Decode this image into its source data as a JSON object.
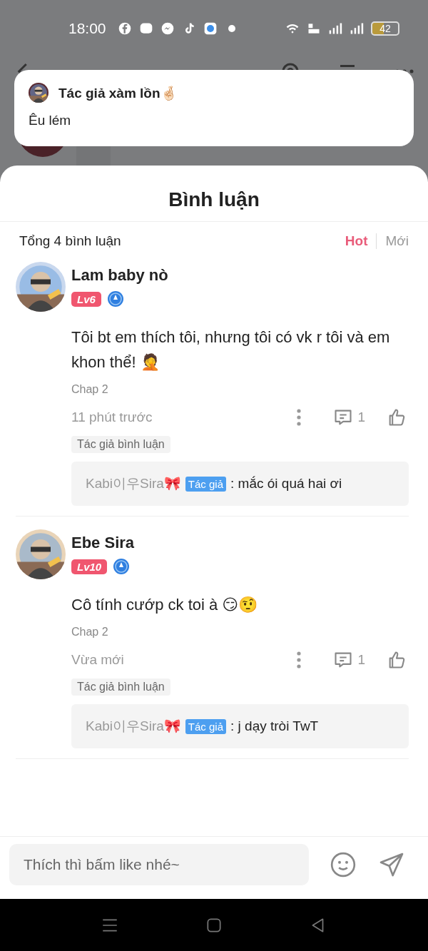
{
  "status_bar": {
    "time": "18:00",
    "battery": "42"
  },
  "notification": {
    "title": "Tác giả xàm lồn🤞🏻",
    "body": "Êu lém"
  },
  "sheet": {
    "title": "Bình luận",
    "total": "Tổng 4 bình luận",
    "sort_tabs": [
      {
        "label": "Hot",
        "selected": true
      },
      {
        "label": "Mới",
        "selected": false
      }
    ],
    "comments": [
      {
        "name": "Lam baby nò",
        "level": "Lv6",
        "text": "Tôi bt em thích tôi, nhưng tôi có vk r tôi và em khon thể! 🤦",
        "chapter": "Chap 2",
        "time": "11 phút trước",
        "reply_count": "1",
        "tag": "Tác giả bình luận",
        "reply": {
          "author": "Kabi이우Sira🎀",
          "badge": "Tác giả",
          "text": ": mắc ói quá hai ơi"
        }
      },
      {
        "name": "Ebe Sira",
        "level": "Lv10",
        "text": "Cô tính cướp ck toi à 😏🤨",
        "chapter": "Chap 2",
        "time": "Vừa mới",
        "reply_count": "1",
        "tag": "Tác giả bình luận",
        "reply": {
          "author": "Kabi이우Sira🎀",
          "badge": "Tác giả",
          "text": ": j dạy tròi TwT"
        }
      }
    ],
    "input": {
      "placeholder": "Thích thì bấm like nhé~"
    }
  }
}
